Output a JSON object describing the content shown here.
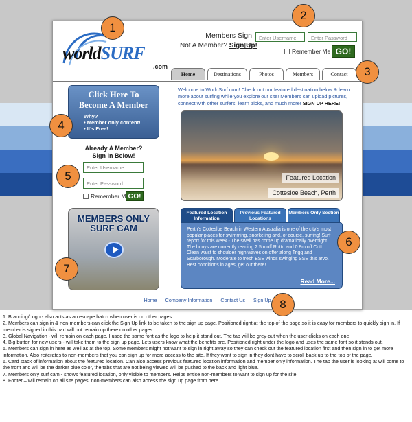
{
  "brand": {
    "name_part1": "world",
    "name_part2": "SURF",
    "suffix": ".com"
  },
  "header": {
    "signin_label": "Members Sign In:",
    "not_member_label": "Not A Member?",
    "signup_link": "Sign Up!",
    "username_placeholder": "Enter Username",
    "password_placeholder": "Enter Password",
    "remember_label": "Remember Me",
    "go_label": "GO!"
  },
  "nav": {
    "tabs": [
      "Home",
      "Destinations",
      "Photos",
      "Members",
      "Contact"
    ]
  },
  "cta": {
    "line1": "Click Here To",
    "line2": "Become A Member",
    "why": "Why?",
    "benefit1": "• Member only content!",
    "benefit2": "• It's Free!"
  },
  "side_signin": {
    "line1": "Already A Member?",
    "line2": "Sign In Below!",
    "username_placeholder": "Enter Username",
    "password_placeholder": "Enter Password",
    "remember_label": "Remember Me",
    "go_label": "GO!"
  },
  "welcome": {
    "text": "Welcome to WorldSurf.com! Check out our featured destination below & learn more about surfing while you explore our site! Members can upload pictures, connect with other surfers, learn tricks, and much more!",
    "cta": "SIGN UP HERE!"
  },
  "featured": {
    "caption1": "Featured Location",
    "caption2": "Cottesloe Beach, Perth"
  },
  "card_tabs": [
    "Featured Location Information",
    "Previous Featured Locations",
    "Members Only Section"
  ],
  "card": {
    "text": "Perth's Cottesloe Beach in Western Australia is one of the city's most popular places for swimming, snorkeling and, of course, surfing! Surf report for this week - The swell has come up dramatically overnight. The buoys are currently reading 2.5m off Rotto and 0.8m off Cott. Clean waist to shoulder high waves on offer along Trigg and Scarborough. Moderate to fresh ESE winds swinging SSE this arvo. Best conditions in ages, get out there!",
    "read_more": "Read More..."
  },
  "surfcam": {
    "title1": "MEMBERS ONLY",
    "title2": "SURF CAM"
  },
  "footer": {
    "links": [
      "Home",
      "Company Information",
      "Contact Us",
      "Sign Up"
    ]
  },
  "markers": [
    "1",
    "2",
    "3",
    "4",
    "5",
    "6",
    "7",
    "8"
  ],
  "notes": [
    "1. Branding/Logo - also acts as an escape hatch when user is on other pages.",
    "2. Members can sign in & non-members can click the Sign Up link to be taken to the sign up page. Positioned right at the top of the page so it is easy for members to quickly sign in. If member is signed in this part will not remain up there on other pages.",
    "3. Global Navigation - will remain on each page. I used the same font as the logo to help it stand out. The tab will be grey-out when the user clicks on each one.",
    "4. Big button for new users - will take them to the sign up page. Lets users know what the benefits are. Positioned right under the logo and uses the same font so it stands out.",
    "5. Members can sign in here as well as at the top. Some members might not want to sign in right away so they can check out the featured location first and then sign in to get more information. Also reiterates to non-members that you can sign up for more access to the site. If they want to sign in they dont have to scroll back up to the top of the page.",
    "6. Card stack of information about the featured location. Can also access previous featured location information and member only information. The tab the user is looking at will come to the front and will be the darker blue color, the tabs that are not being viewed will be pushed to the back and light blue.",
    "7. Members only surf cam - shows featured location, only visible to members. Helps entice non-members to want to sign up for the site.",
    "8. Footer – will remain on all site pages, non-members can also access the sign up page from here."
  ],
  "colors": {
    "accent_blue": "#2b55a0",
    "go_green": "#2f6a1f",
    "marker_orange": "#f09040"
  }
}
